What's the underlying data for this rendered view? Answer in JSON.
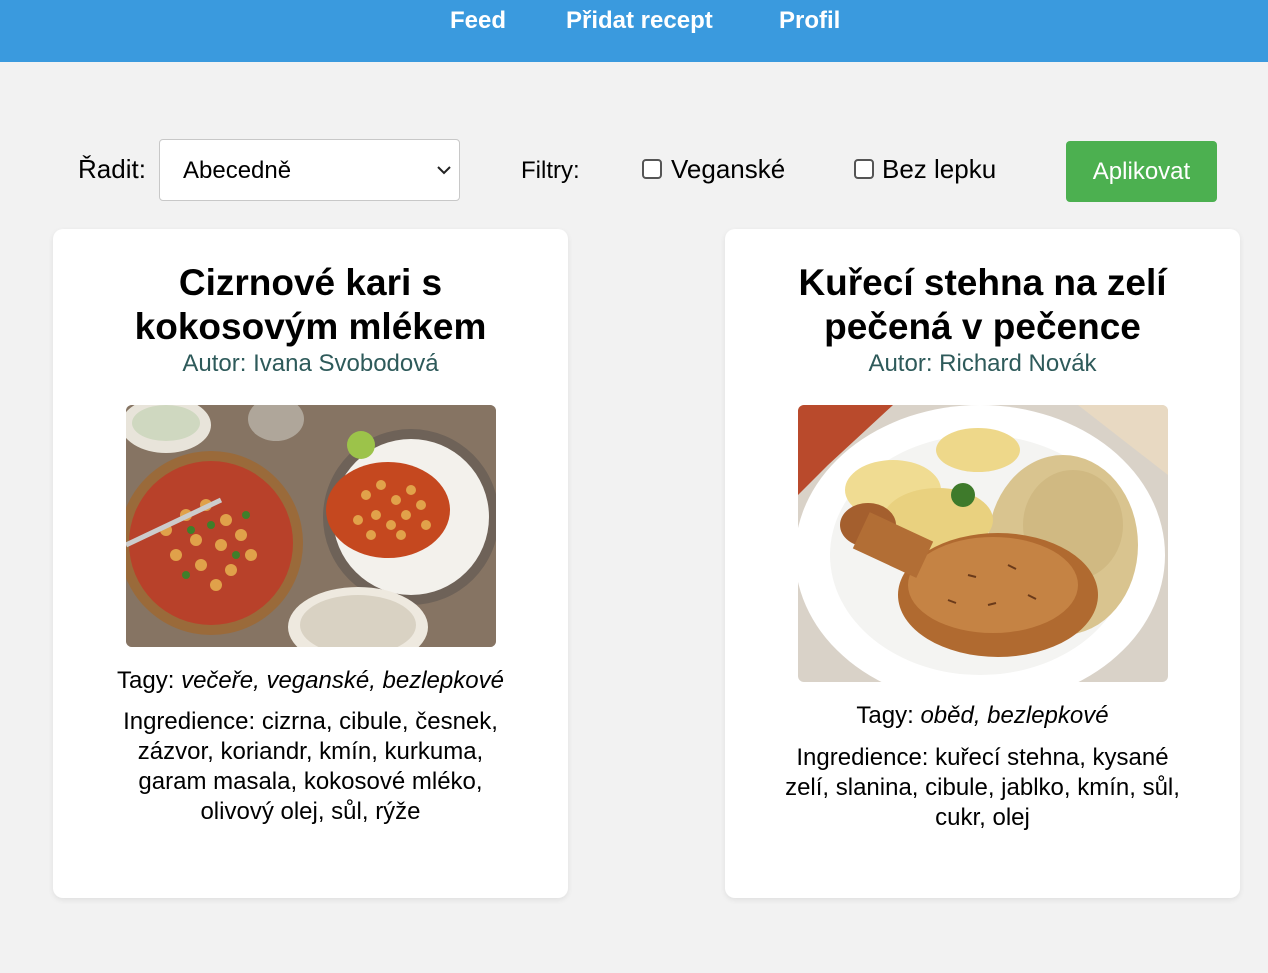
{
  "nav": {
    "feed": "Feed",
    "add_recipe": "Přidat recept",
    "profile": "Profil"
  },
  "controls": {
    "sort_label": "Řadit:",
    "sort_value": "Abecedně",
    "filters_label": "Filtry:",
    "vegan_label": "Veganské",
    "vegan_checked": false,
    "gluten_free_label": "Bez lepku",
    "gluten_free_checked": false,
    "apply_label": "Aplikovat"
  },
  "recipes": [
    {
      "title": "Cizrnové kari s kokosovým mlékem",
      "author": "Autor: Ivana Svobodová",
      "tags_label": "Tagy:",
      "tags": "večeře, veganské, bezlepkové",
      "ingredients": "Ingredience: cizrna, cibule, česnek, zázvor, koriandr, kmín, kurkuma, garam masala, kokosové mléko, olivový olej, sůl, rýže"
    },
    {
      "title": "Kuřecí stehna na zelí pečená v pečence",
      "author": "Autor: Richard Novák",
      "tags_label": "Tagy:",
      "tags": "oběd, bezlepkové",
      "ingredients": "Ingredience: kuřecí stehna, kysané zelí, slanina, cibule, jablko, kmín, sůl, cukr, olej"
    }
  ],
  "colors": {
    "topbar": "#3a9ade",
    "apply_button": "#4cb050",
    "author_text": "#2e5a5a",
    "background": "#f2f2f2"
  }
}
